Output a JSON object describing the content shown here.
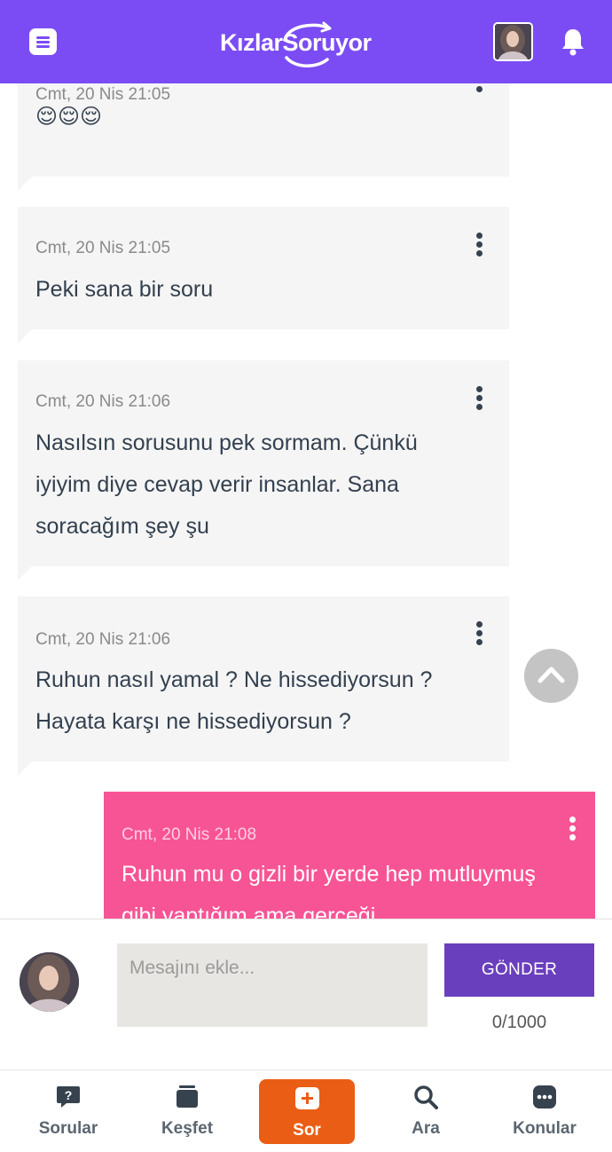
{
  "header": {
    "logo_part1": "Kızlar",
    "logo_part2": "Soruyor"
  },
  "messages": [
    {
      "time": "Cmt, 20 Nis 21:05",
      "text": "😌😌😌",
      "mine": false
    },
    {
      "time": "Cmt, 20 Nis 21:05",
      "text": "Peki sana bir soru",
      "mine": false
    },
    {
      "time": "Cmt, 20 Nis 21:06",
      "text": "Nasılsın sorusunu pek sormam. Çünkü iyiyim diye cevap verir insanlar. Sana soracağım şey şu",
      "mine": false
    },
    {
      "time": "Cmt, 20 Nis 21:06",
      "text": "Ruhun nasıl yamal ? Ne hissediyorsun ? Hayata karşı ne hissediyorsun ?",
      "mine": false
    },
    {
      "time": "Cmt, 20 Nis 21:08",
      "text": "Ruhun mu o gizli bir yerde hep mutluymuş gibi yaptığım ama gerçeği",
      "mine": true
    }
  ],
  "composer": {
    "placeholder": "Mesajını ekle...",
    "send_label": "GÖNDER",
    "counter": "0/1000"
  },
  "nav": [
    {
      "label": "Sorular",
      "icon": "question-bubble-icon"
    },
    {
      "label": "Keşfet",
      "icon": "cards-icon"
    },
    {
      "label": "Sor",
      "icon": "plus-square-icon"
    },
    {
      "label": "Ara",
      "icon": "search-icon"
    },
    {
      "label": "Konular",
      "icon": "chat-dots-icon"
    }
  ],
  "colors": {
    "header": "#7b4cf4",
    "incoming_bubble": "#f5f5f5",
    "outgoing_bubble": "#f75495",
    "send_button": "#6a3fbd",
    "ask_button": "#ea5d14"
  }
}
